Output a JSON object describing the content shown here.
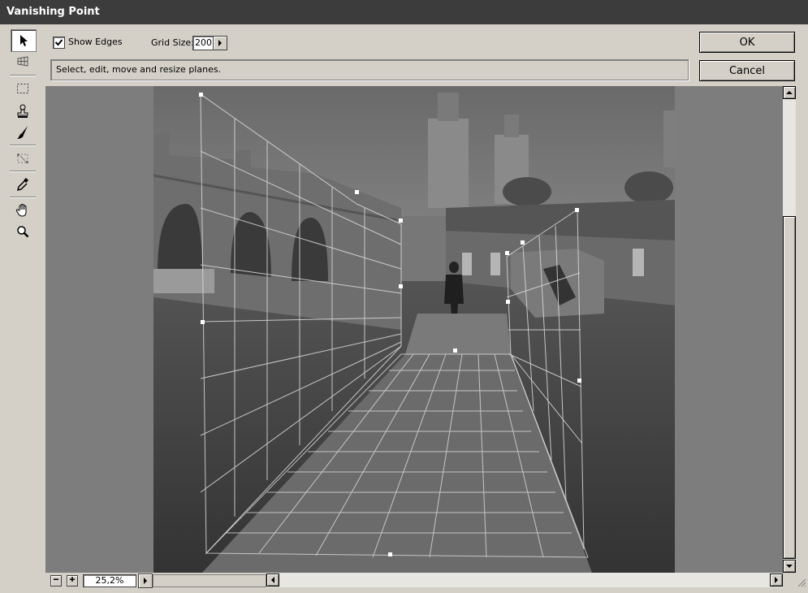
{
  "window": {
    "title": "Vanishing Point"
  },
  "toolbar": {
    "show_edges_label": "Show Edges",
    "show_edges_checked": true,
    "grid_size_label": "Grid Size:",
    "grid_size_value": "200"
  },
  "status": {
    "text": "Select, edit, move and resize planes."
  },
  "buttons": {
    "ok": "OK",
    "cancel": "Cancel"
  },
  "tools": [
    {
      "icon": "arrow-select-icon",
      "active": true
    },
    {
      "icon": "create-plane-icon",
      "active": false
    },
    {
      "icon": "marquee-icon",
      "active": false
    },
    {
      "icon": "stamp-icon",
      "active": false
    },
    {
      "icon": "brush-icon",
      "active": false
    },
    {
      "icon": "transform-icon",
      "active": false
    },
    {
      "icon": "eyedropper-icon",
      "active": false
    },
    {
      "icon": "hand-icon",
      "active": false
    },
    {
      "icon": "zoom-icon",
      "active": false
    }
  ],
  "zoom": {
    "value": "25,2%"
  }
}
